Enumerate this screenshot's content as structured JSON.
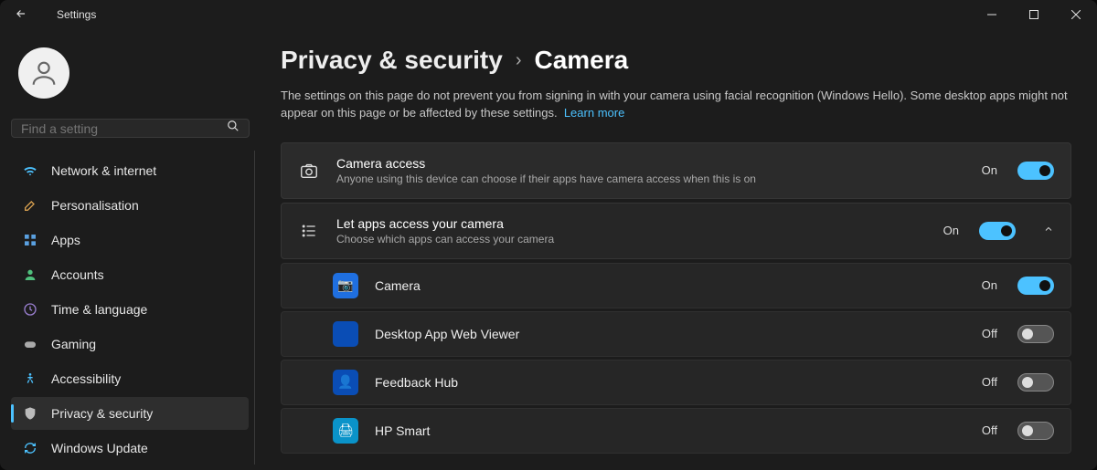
{
  "window": {
    "title": "Settings"
  },
  "search": {
    "placeholder": "Find a setting"
  },
  "sidebar": {
    "items": [
      {
        "icon": "wifi",
        "label": "Network & internet"
      },
      {
        "icon": "brush",
        "label": "Personalisation"
      },
      {
        "icon": "apps",
        "label": "Apps"
      },
      {
        "icon": "person",
        "label": "Accounts"
      },
      {
        "icon": "clock",
        "label": "Time & language"
      },
      {
        "icon": "game",
        "label": "Gaming"
      },
      {
        "icon": "access",
        "label": "Accessibility"
      },
      {
        "icon": "shield",
        "label": "Privacy & security"
      },
      {
        "icon": "update",
        "label": "Windows Update"
      }
    ],
    "active_index": 7
  },
  "breadcrumb": {
    "a": "Privacy & security",
    "b": "Camera"
  },
  "description": {
    "text": "The settings on this page do not prevent you from signing in with your camera using facial recognition (Windows Hello). Some desktop apps might not appear on this page or be affected by these settings.",
    "link": "Learn more"
  },
  "cards": {
    "camera_access": {
      "title": "Camera access",
      "sub": "Anyone using this device can choose if their apps have camera access when this is on",
      "state": "On",
      "on": true
    },
    "let_apps": {
      "title": "Let apps access your camera",
      "sub": "Choose which apps can access your camera",
      "state": "On",
      "on": true,
      "expanded": true
    }
  },
  "apps": [
    {
      "name": "Camera",
      "state": "On",
      "on": true,
      "icon_color": "ic-cam",
      "glyph": "📷"
    },
    {
      "name": "Desktop App Web Viewer",
      "state": "Off",
      "on": false,
      "icon_color": "ic-blue",
      "glyph": ""
    },
    {
      "name": "Feedback Hub",
      "state": "Off",
      "on": false,
      "icon_color": "ic-blue",
      "glyph": "👤"
    },
    {
      "name": "HP Smart",
      "state": "Off",
      "on": false,
      "icon_color": "ic-teal",
      "glyph": "🖨"
    }
  ]
}
